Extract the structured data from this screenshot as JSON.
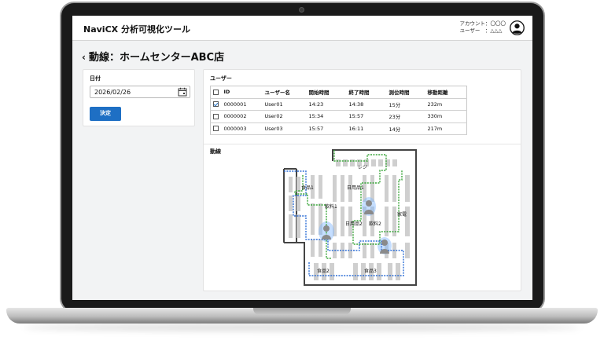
{
  "app": {
    "title": "NaviCX 分析可視化ツール",
    "account_line": "アカウント：〇〇〇",
    "user_line": "ユーザー　：△△△"
  },
  "page": {
    "back_glyph": "‹",
    "title": "動線：ホームセンターABC店"
  },
  "date_panel": {
    "label": "日付",
    "value": "2026/02/26",
    "submit_label": "決定"
  },
  "users": {
    "label": "ユーザー",
    "columns": [
      "ID",
      "ユーザー名",
      "開始時間",
      "終了時間",
      "測位時間",
      "移動距離"
    ],
    "rows": [
      {
        "checked": true,
        "id": "0000001",
        "name": "User01",
        "start": "14:23",
        "end": "14:38",
        "duration": "15分",
        "distance": "232m"
      },
      {
        "checked": false,
        "id": "0000002",
        "name": "User02",
        "start": "15:34",
        "end": "15:57",
        "duration": "23分",
        "distance": "330m"
      },
      {
        "checked": false,
        "id": "0000003",
        "name": "User03",
        "start": "15:57",
        "end": "16:11",
        "duration": "14分",
        "distance": "217m"
      }
    ]
  },
  "flow": {
    "label": "動線",
    "zones": {
      "register": "レジ",
      "food1": "食品1",
      "daily1": "日用品1",
      "drink1": "飲料1",
      "appliance": "家電",
      "daily2": "日用品2",
      "drink2": "飲料2",
      "food2": "食品2",
      "food3": "食品3"
    },
    "colors": {
      "green_path": "#3aa63a",
      "blue_path": "#2e6fd6",
      "hotspot": "#7fb8ff",
      "shelf": "#cfcfcf",
      "wall": "#444444"
    }
  },
  "colors": {
    "accent": "#1e6fc4",
    "screen_bg": "#f2f3f4"
  }
}
